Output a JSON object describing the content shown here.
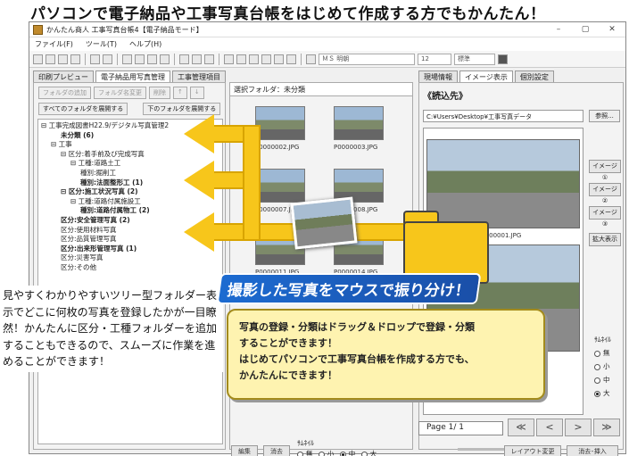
{
  "headline": "パソコンで電子納品や工事写真台帳をはじめて作成する方でもかんたん！",
  "window": {
    "title": "かんたん商人 工事写真台帳4【電子納品モード】",
    "controls": [
      "–",
      "▢",
      "✕"
    ]
  },
  "menu": [
    "ファイル(F)",
    "ツール(T)",
    "ヘルプ(H)"
  ],
  "toolbar": {
    "font_select": "ＭＳ 明朝",
    "size_select": "12",
    "style_select": "標準"
  },
  "main_tabs": [
    "印刷プレビュー",
    "電子納品用写真管理",
    "工事管理項目"
  ],
  "right_tabs": [
    "現場情報",
    "イメージ表示",
    "個別設定"
  ],
  "left": {
    "buttons": [
      "フォルダの追加",
      "フォルダ名変更",
      "削除",
      "↑",
      "↓"
    ],
    "expand_all": "すべてのフォルダを展開する",
    "expand_below": "下のフォルダを展開する",
    "tree": [
      {
        "text": "⊟ 工事完成図書H22.9/デジタル写真管理2",
        "indent": 0,
        "bold": false
      },
      {
        "text": "未分類 (6)",
        "indent": 2,
        "bold": true
      },
      {
        "text": "⊟ 工事",
        "indent": 1,
        "bold": false
      },
      {
        "text": "⊟ 区分:着手前及び完成写真",
        "indent": 2,
        "bold": false
      },
      {
        "text": "⊟ 工種:道路土工",
        "indent": 3,
        "bold": false
      },
      {
        "text": "種別:掘削工",
        "indent": 4,
        "bold": false
      },
      {
        "text": "種別:法面整形工 (1)",
        "indent": 4,
        "bold": true
      },
      {
        "text": "⊟ 区分:施工状況写真 (2)",
        "indent": 2,
        "bold": true
      },
      {
        "text": "⊟ 工種:道路付属施設工",
        "indent": 3,
        "bold": false
      },
      {
        "text": "種別:道路付属物工 (2)",
        "indent": 4,
        "bold": true
      },
      {
        "text": "区分:安全管理写真 (2)",
        "indent": 2,
        "bold": true
      },
      {
        "text": "区分:使用材料写真",
        "indent": 2,
        "bold": false
      },
      {
        "text": "区分:品質管理写真",
        "indent": 2,
        "bold": false
      },
      {
        "text": "区分:出来形管理写真 (1)",
        "indent": 2,
        "bold": true
      },
      {
        "text": "区分:災害写真",
        "indent": 2,
        "bold": false
      },
      {
        "text": "区分:その他",
        "indent": 2,
        "bold": false
      }
    ]
  },
  "middle": {
    "selected_folder": "選択フォルダ：未分類",
    "thumbnails": [
      "P0000002.JPG",
      "P0000003.JPG",
      "P0000007.JPG",
      "P0000008.JPG",
      "P0000011.JPG",
      "P0000014.JPG"
    ],
    "edit_button": "編集",
    "delete_button": "消去",
    "thumb_label": "ｻﾑﾈｲﾙ",
    "thumb_options": [
      "無",
      "小",
      "中",
      "大"
    ],
    "thumb_selected": "中"
  },
  "right": {
    "read_title": "《読込先》",
    "path": "C:¥Users¥Desktop¥工事写真データ",
    "browse_button": "参照...",
    "image_buttons": [
      "イメージ①",
      "イメージ②",
      "イメージ③"
    ],
    "zoom_button": "拡大表示",
    "preview_label": "P0000001.JPG",
    "thumb_label": "ｻﾑﾈｲﾙ",
    "thumb_options": [
      "無",
      "小",
      "中",
      "大"
    ],
    "thumb_selected": "大",
    "page": "Page 1/ 1",
    "nav": [
      "≪",
      "<",
      ">",
      "≫"
    ],
    "layout_button": "レイアウト変更",
    "delete_insert_button": "消去･挿入"
  },
  "callouts": {
    "left_text": "見やすくわかりやすいツリー型フォルダー表示でどこに何枚の写真を登録したかが一目瞭然！かんたんに区分・工種フォルダーを追加することもできるので、スムーズに作業を進めることができます！",
    "banner": "撮影した写真をマウスで振り分け！",
    "box_line1": "写真の登録・分類はドラッグ＆ドロップで登録・分類",
    "box_line2": "することができます！",
    "box_line3": "はじめてパソコンで工事写真台帳を作成する方でも、",
    "box_line4": "かんたんにできます！"
  },
  "colors": {
    "arrow": "#f7c61b",
    "banner": "#1c6bd1",
    "callout_bg": "#fef3b0"
  }
}
